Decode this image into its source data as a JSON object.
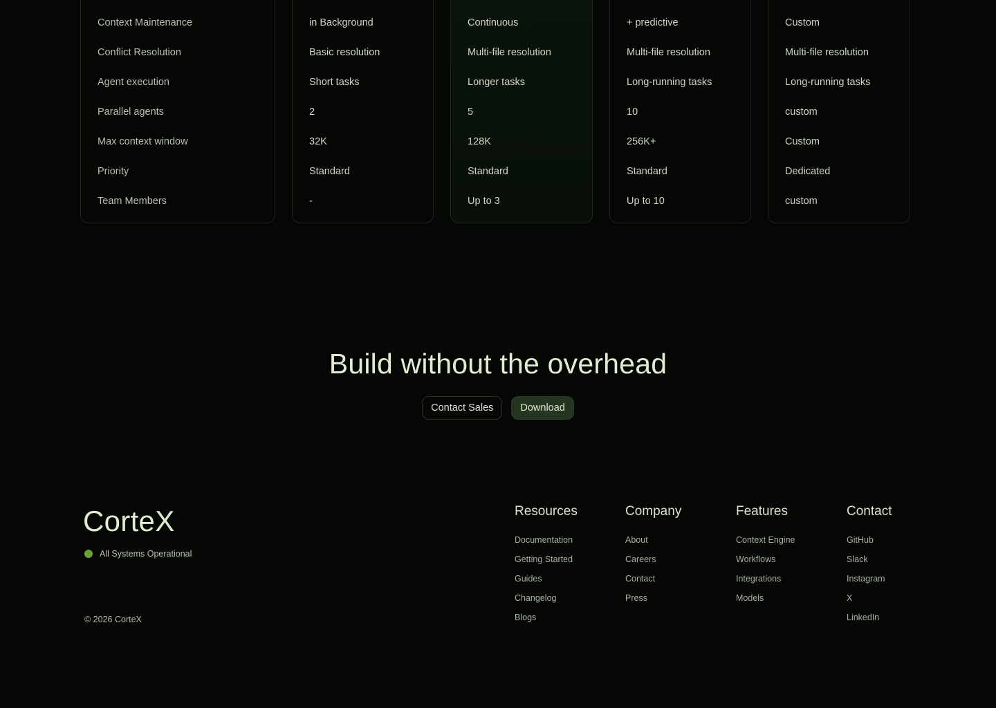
{
  "comparison": {
    "labels": [
      "Context Maintenance",
      "Conflict Resolution",
      "Agent execution",
      "Parallel agents",
      "Max context window",
      "Priority",
      "Team Members"
    ],
    "plans": [
      {
        "values": [
          "in Background",
          "Basic resolution",
          "Short tasks",
          "2",
          "32K",
          "Standard",
          "-"
        ]
      },
      {
        "values": [
          "Continuous",
          "Multi-file resolution",
          "Longer tasks",
          "5",
          "128K",
          "Standard",
          "Up to 3"
        ]
      },
      {
        "values": [
          "+ predictive",
          "Multi-file resolution",
          "Long-running tasks",
          "10",
          "256K+",
          "Standard",
          "Up to 10"
        ]
      },
      {
        "values": [
          "Custom",
          "Multi-file resolution",
          "Long-running tasks",
          "custom",
          "Custom",
          "Dedicated",
          "custom"
        ]
      }
    ]
  },
  "cta": {
    "title": "Build without the overhead",
    "contact_label": "Contact Sales",
    "download_label": "Download"
  },
  "footer": {
    "brand": "CorteX",
    "status_text": "All Systems Operational",
    "status_color": "#6c9e36",
    "copyright": "© 2026 CorteX",
    "columns": [
      {
        "heading": "Resources",
        "links": [
          "Documentation",
          "Getting Started",
          "Guides",
          "Changelog",
          "Blogs"
        ]
      },
      {
        "heading": "Company",
        "links": [
          "About",
          "Careers",
          "Contact",
          "Press"
        ]
      },
      {
        "heading": "Features",
        "links": [
          "Context Engine",
          "Workflows",
          "Integrations",
          "Models"
        ]
      },
      {
        "heading": "Contact",
        "links": [
          "GitHub",
          "Slack",
          "Instagram",
          "X",
          "LinkedIn"
        ]
      }
    ]
  }
}
